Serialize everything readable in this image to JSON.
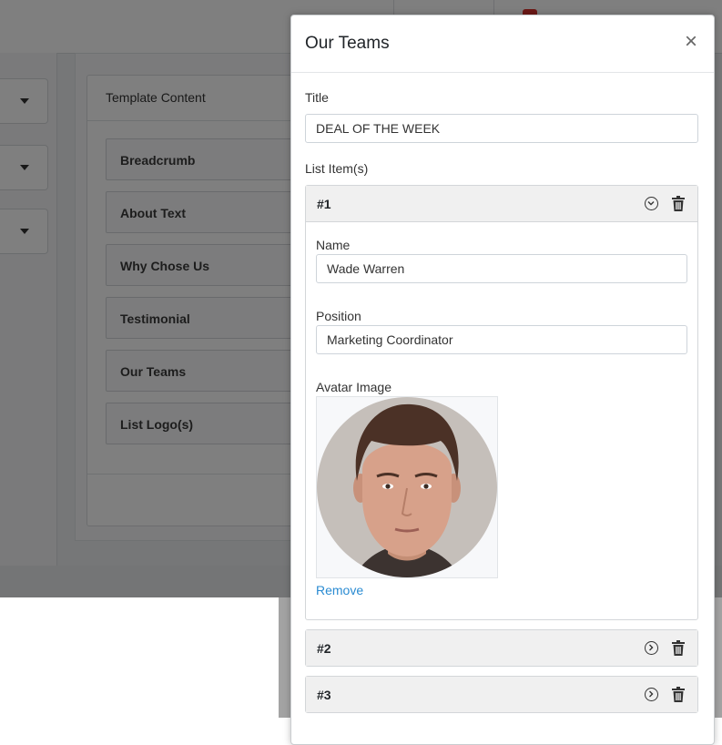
{
  "background": {
    "template_card": {
      "title": "Template Content",
      "items": [
        {
          "label": "Breadcrumb"
        },
        {
          "label": "About Text"
        },
        {
          "label": "Why Chose Us"
        },
        {
          "label": "Testimonial"
        },
        {
          "label": "Our Teams"
        },
        {
          "label": "List Logo(s)"
        }
      ]
    }
  },
  "modal": {
    "title": "Our Teams",
    "close_icon": "×",
    "title_field": {
      "label": "Title",
      "value": "DEAL OF THE WEEK"
    },
    "list_label": "List Item(s)",
    "items": [
      {
        "number": "#1",
        "expanded": true,
        "name_label": "Name",
        "name_value": "Wade Warren",
        "position_label": "Position",
        "position_value": "Marketing Coordinator",
        "avatar_label": "Avatar Image",
        "remove_label": "Remove"
      },
      {
        "number": "#2",
        "expanded": false
      },
      {
        "number": "#3",
        "expanded": false
      }
    ]
  },
  "colors": {
    "link": "#2a8bd2",
    "badge": "#d9312b",
    "overlay": "rgba(0,0,0,0.5)"
  }
}
